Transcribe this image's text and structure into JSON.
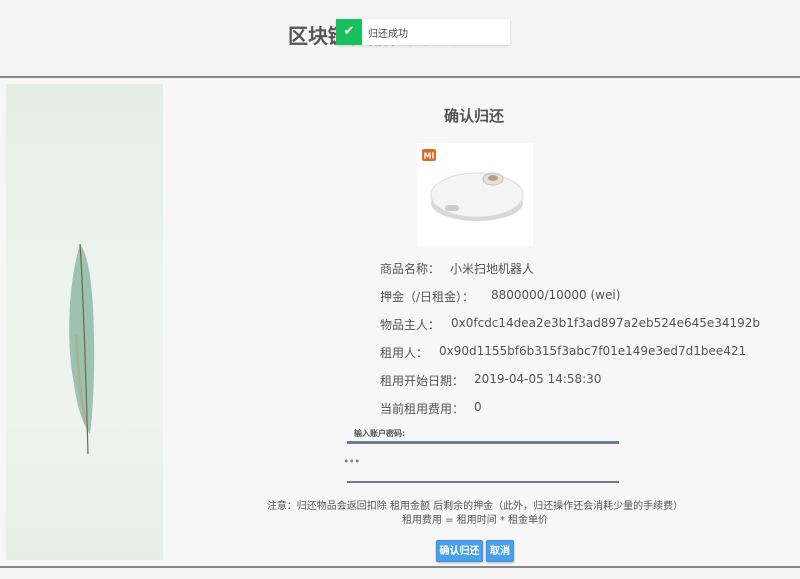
{
  "header": {
    "title": "区块链物品租赁系统"
  },
  "toast": {
    "message": "归还成功",
    "icon": "check-icon",
    "color": "#18c060"
  },
  "dialog": {
    "title": "确认归还",
    "product_image": {
      "brand": "MI",
      "icon": "robot-vacuum-image"
    },
    "fields": [
      {
        "label": "商品名称：",
        "value": "小米扫地机器人"
      },
      {
        "label": "押金（/日租金）：",
        "value": "8800000/10000 (wei)"
      },
      {
        "label": "物品主人：",
        "value": "0x0fcdc14dea2e3b1f3ad897a2eb524e645e34192b"
      },
      {
        "label": "租用人：",
        "value": "0x90d1155bf6b315f3abc7f01e149e3ed7d1bee421"
      },
      {
        "label": "租用开始日期：",
        "value": "2019-04-05 14:58:30"
      },
      {
        "label": "当前租用费用：",
        "value": "0"
      }
    ],
    "password": {
      "label": "输入账户密码:",
      "masked_value": "•••"
    },
    "notice_line1": "注意：归还物品会返回扣除 租用金额 后剩余的押金（此外，归还操作还会消耗少量的手续费）",
    "notice_line2": "租用费用 = 租用时间 * 租金单价",
    "confirm_label": "确认归还",
    "cancel_label": "取消"
  },
  "colors": {
    "button": "#4aa0ea",
    "divider": "#888888",
    "brand": "#e2672a"
  }
}
